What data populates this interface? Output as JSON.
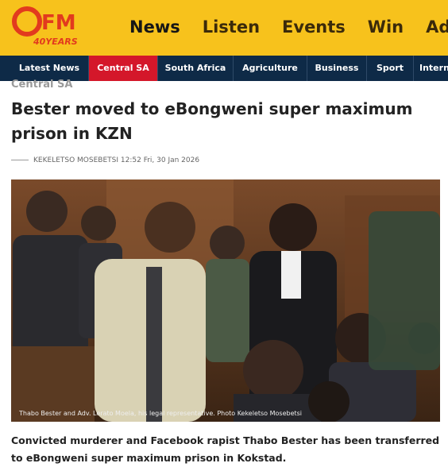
{
  "header": {
    "logo_text": "OFM",
    "logo_tagline": "40YEARS",
    "nav": [
      {
        "label": "News",
        "active": true
      },
      {
        "label": "Listen",
        "active": false
      },
      {
        "label": "Events",
        "active": false
      },
      {
        "label": "Win",
        "active": false
      },
      {
        "label": "Adver",
        "active": false
      }
    ]
  },
  "subnav": {
    "items": [
      {
        "label": "Latest News",
        "active": false
      },
      {
        "label": "Central SA",
        "active": true
      },
      {
        "label": "South Africa",
        "active": false
      },
      {
        "label": "Agriculture",
        "active": false
      },
      {
        "label": "Business",
        "active": false
      },
      {
        "label": "Sport",
        "active": false
      },
      {
        "label": "Intern",
        "active": false
      }
    ]
  },
  "article": {
    "category": "Central SA",
    "headline": "Bester moved to eBongweni super maximum prison in KZN",
    "author": "KEKELETSO MOSEBETSI",
    "datetime": "12:52 Fri, 30 Jan 2026",
    "photo_caption": "Thabo Bester and Adv. Lerato Moela, his legal representative. Photo Kekeletso Mosebetsi",
    "lede": "Convicted murderer and Facebook rapist Thabo Bester has been transferred to eBongweni super maximum prison in Kokstad."
  },
  "colors": {
    "header_bg": "#f7c21c",
    "subnav_bg": "#0e2a47",
    "subnav_active": "#d4172a",
    "logo_red": "#e23a1e"
  }
}
